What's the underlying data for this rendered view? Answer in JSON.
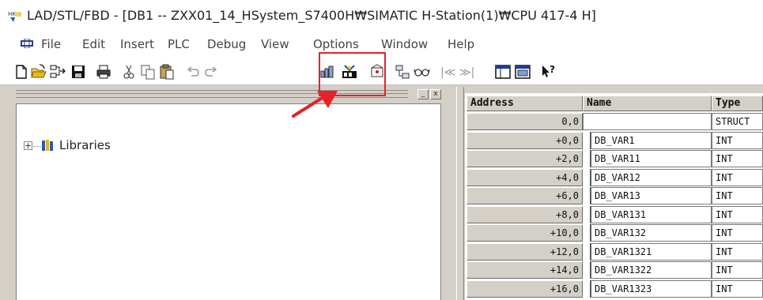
{
  "window": {
    "title": "LAD/STL/FBD  - [DB1 -- ZXX01_14_HSystem_S7400H₩SIMATIC H-Station(1)₩CPU 417-4 H]"
  },
  "menu": {
    "items": [
      "File",
      "Edit",
      "Insert",
      "PLC",
      "Debug",
      "View",
      "Options",
      "Window",
      "Help"
    ]
  },
  "toolbar": {
    "icons": [
      "new-icon",
      "open-icon",
      "accessible-nodes-icon",
      "save-icon",
      "print-icon",
      "cut-icon",
      "copy-icon",
      "paste-icon",
      "undo-icon",
      "redo-icon",
      "load-icon",
      "monitor-icon",
      "catalog-icon",
      "network-icon",
      "glasses-icon",
      "navigate-icons",
      "overview-icon",
      "details-icon",
      "help-icon"
    ]
  },
  "tree": {
    "root_label": "Libraries",
    "expand_symbol": "+"
  },
  "pane_buttons": [
    "_",
    "x"
  ],
  "table": {
    "headers": {
      "address": "Address",
      "name": "Name",
      "type": "Type"
    },
    "rows": [
      {
        "address": "0,0",
        "name": "",
        "type": "STRUCT"
      },
      {
        "address": "+0,0",
        "name": "DB_VAR1",
        "type": "INT"
      },
      {
        "address": "+2,0",
        "name": "DB_VAR11",
        "type": "INT"
      },
      {
        "address": "+4,0",
        "name": "DB_VAR12",
        "type": "INT"
      },
      {
        "address": "+6,0",
        "name": "DB_VAR13",
        "type": "INT"
      },
      {
        "address": "+8,0",
        "name": "DB_VAR131",
        "type": "INT"
      },
      {
        "address": "+10,0",
        "name": "DB_VAR132",
        "type": "INT"
      },
      {
        "address": "+12,0",
        "name": "DB_VAR1321",
        "type": "INT"
      },
      {
        "address": "+14,0",
        "name": "DB_VAR1322",
        "type": "INT"
      },
      {
        "address": "+16,0",
        "name": "DB_VAR1323",
        "type": "INT"
      }
    ]
  },
  "annotation": {
    "highlight_color": "#e8202a"
  }
}
